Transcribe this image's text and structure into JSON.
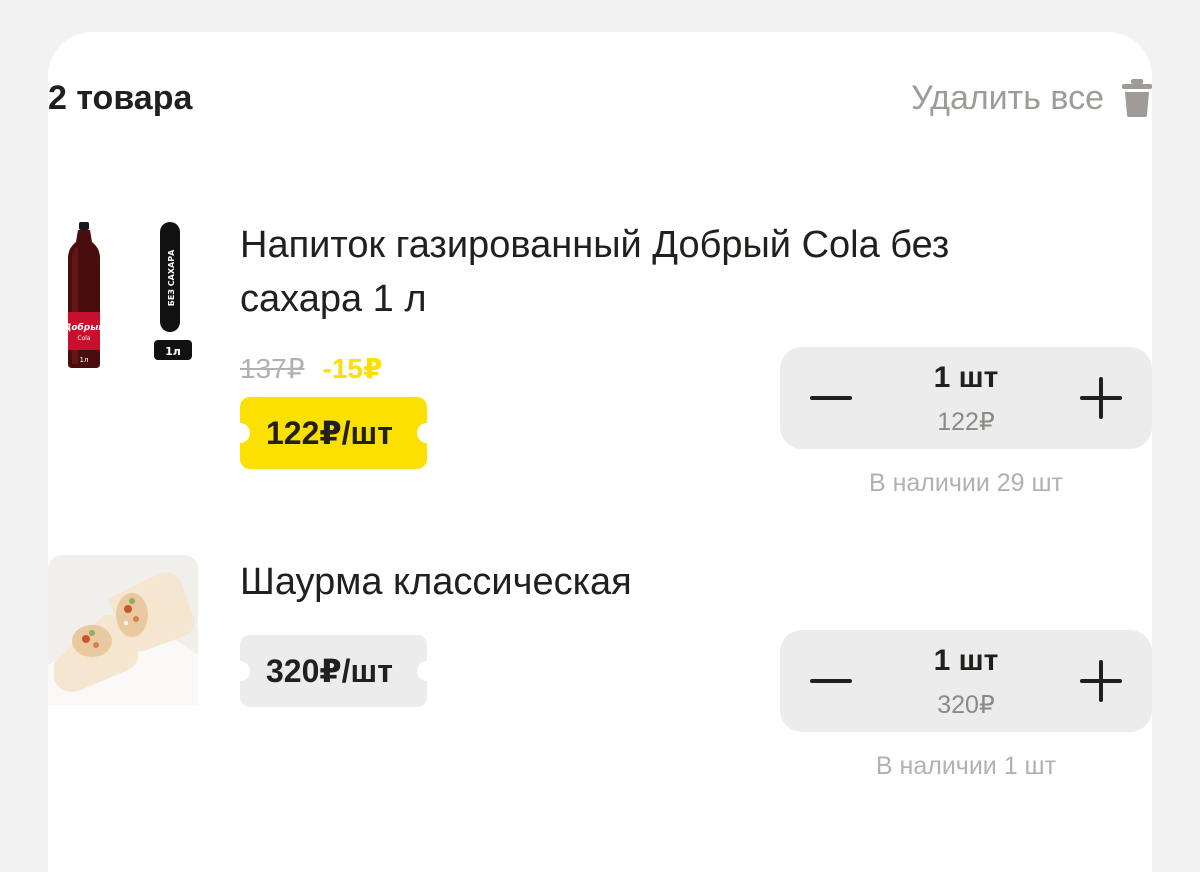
{
  "cart": {
    "count_label": "2 товара",
    "delete_all_label": "Удалить все",
    "delete_icon": "trash-icon"
  },
  "items": [
    {
      "title": "Напиток газированный Добрый Cola без сахара 1 л",
      "old_price": "137₽",
      "discount": "-15₽",
      "price": "122₽/шт",
      "quantity": "1 шт",
      "sum": "122₽",
      "stock": "В наличии 29 шт",
      "image_labels": {
        "brand": "Добрый",
        "sub": "Cola",
        "volume": "1л",
        "band_text": "БЕЗ САХАРА",
        "band_volume": "1л"
      },
      "price_tag_color": "#fce000"
    },
    {
      "title": "Шаурма классическая",
      "price": "320₽/шт",
      "quantity": "1 шт",
      "sum": "320₽",
      "stock": "В наличии 1 шт",
      "price_tag_color": "#ececec"
    }
  ],
  "colors": {
    "accent": "#fce000",
    "text": "#21201f",
    "muted": "#9e9b98",
    "control_bg": "#ececec"
  }
}
